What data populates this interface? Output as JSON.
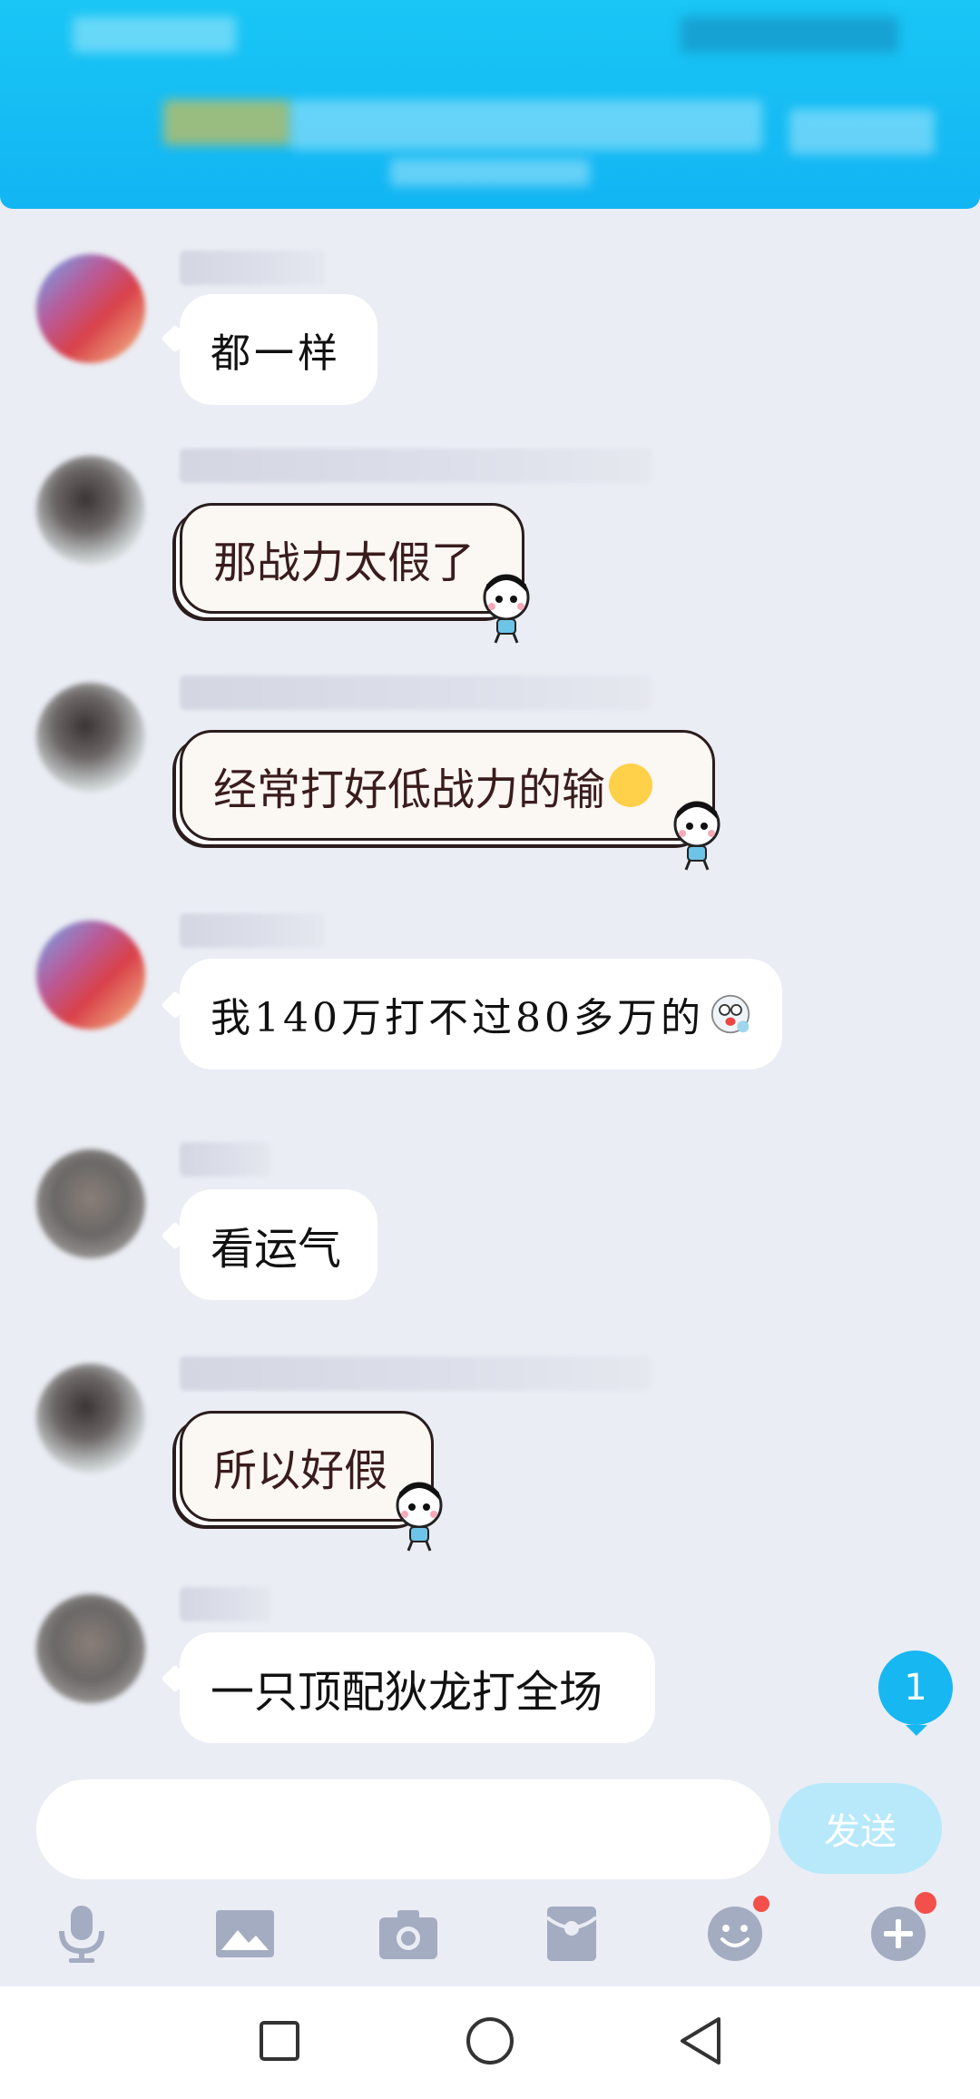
{
  "messages": [
    {
      "text": "都一样"
    },
    {
      "text": "那战力太假了"
    },
    {
      "text": "经常打好低战力的输"
    },
    {
      "text": "我140万打不过80多万的"
    },
    {
      "text": "看运气"
    },
    {
      "text": "所以好假"
    },
    {
      "text": "一只顶配狄龙打全场"
    }
  ],
  "unread_badge": "1",
  "composer": {
    "placeholder": "",
    "send_label": "发送"
  },
  "toolbar": {
    "icons": [
      "microphone-icon",
      "image-icon",
      "camera-icon",
      "red-packet-icon",
      "emoji-icon",
      "plus-icon"
    ]
  },
  "navbar": {
    "icons": [
      "recents-square-icon",
      "home-circle-icon",
      "back-triangle-icon"
    ]
  },
  "colors": {
    "accent": "#12b5f3",
    "send_disabled": "#b7e9fb",
    "badge": "#17b7f2",
    "notify_dot": "#f3504b"
  }
}
